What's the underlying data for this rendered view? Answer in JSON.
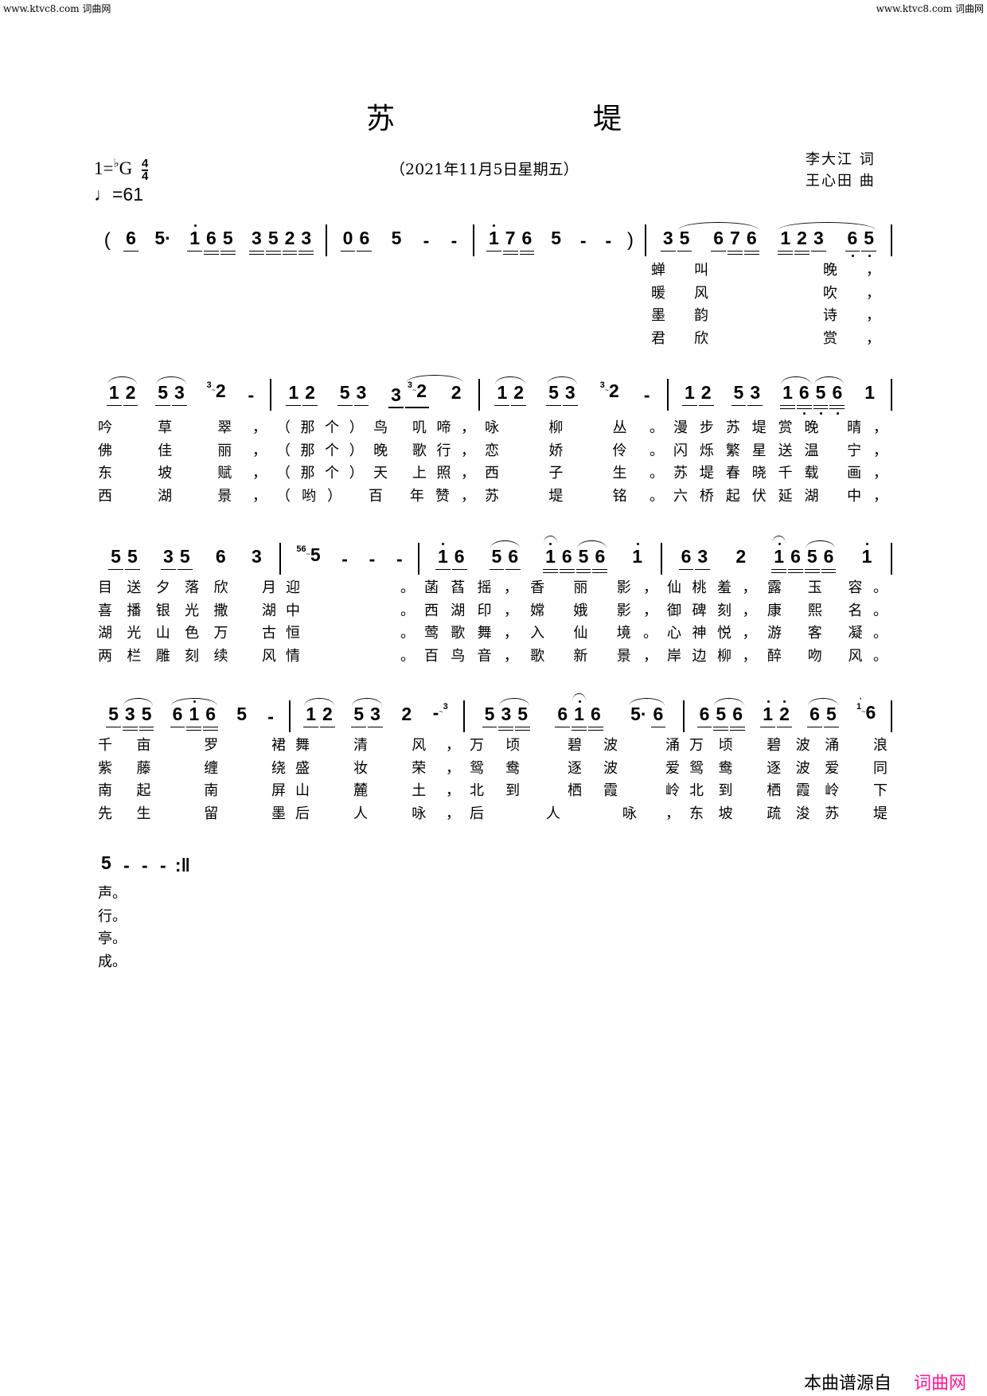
{
  "site": {
    "left": "www.ktvc8.com 词曲网",
    "right": "www.ktvc8.com 词曲网"
  },
  "title": [
    "苏",
    "堤"
  ],
  "key": {
    "prefix": "1=",
    "flat": "♭",
    "note": "G",
    "time_top": "4",
    "time_bottom": "4"
  },
  "tempo": {
    "symbol": "♩",
    "value": "=61"
  },
  "date": "（2021年11月5日星期五）",
  "lyricist": "李大江 词",
  "composer": "王心田 曲",
  "rows": [
    {
      "measures": [
        [
          "(",
          {
            "n": [
              "6"
            ],
            "u": [
              1
            ]
          },
          "5·",
          {
            "n": [
              "1'",
              "6",
              "5"
            ],
            "u": [
              1,
              2,
              2
            ]
          },
          {
            "n": [
              "3",
              "5",
              "2",
              "3"
            ],
            "u": [
              2,
              2,
              2,
              2
            ]
          }
        ],
        [
          {
            "n": [
              "0",
              "6"
            ],
            "u": [
              1,
              1
            ]
          },
          "5",
          "-",
          "-"
        ],
        [
          {
            "n": [
              "1'",
              "7",
              "6"
            ],
            "u": [
              1,
              2,
              2
            ]
          },
          "5",
          "-",
          "-",
          ")"
        ],
        [
          {
            "n": [
              "3",
              "5"
            ],
            "u": [
              1,
              1
            ],
            "s": [
              [
                1,
                1,
                "next"
              ]
            ]
          },
          {
            "n": [
              "6",
              "7",
              "6"
            ],
            "u": [
              1,
              2,
              2
            ],
            "s": [
              [
                -1,
                2
              ]
            ]
          },
          {
            "n": [
              "1",
              "2",
              "3"
            ],
            "u": [
              2,
              2,
              1
            ],
            "s": [
              [
                0,
                0,
                "next"
              ]
            ]
          },
          {
            "n": [
              "6,",
              "5,"
            ],
            "u": [
              1,
              1
            ],
            "s": [
              [
                -1,
                1
              ]
            ]
          }
        ]
      ],
      "verses": [
        [
          "",
          "",
          "",
          "蝉叫　　晚，　"
        ],
        [
          "",
          "",
          "",
          "暖风　　吹，　"
        ],
        [
          "",
          "",
          "",
          "墨韵　　诗，　"
        ],
        [
          "",
          "",
          "",
          "君欣　　赏，　"
        ]
      ]
    },
    {
      "measures": [
        [
          {
            "n": [
              "1",
              "2"
            ],
            "u": [
              1,
              1
            ],
            "s": [
              [
                0,
                1
              ]
            ]
          },
          {
            "n": [
              "5",
              "3"
            ],
            "u": [
              1,
              1
            ],
            "s": [
              [
                0,
                1
              ]
            ]
          },
          "3~2",
          "-"
        ],
        [
          {
            "n": [
              "1",
              "2"
            ],
            "u": [
              1,
              1
            ]
          },
          {
            "n": [
              "5",
              "3"
            ],
            "u": [
              1,
              1
            ]
          },
          {
            "n": [
              "3",
              "3~2"
            ],
            "u": [
              1,
              1
            ],
            "s": [
              [
                1,
                1,
                "next"
              ]
            ]
          },
          {
            "n": [
              "2"
            ],
            "u": [
              0
            ],
            "s": [
              [
                -1,
                0
              ]
            ]
          }
        ],
        [
          {
            "n": [
              "1",
              "2"
            ],
            "u": [
              1,
              1
            ],
            "s": [
              [
                0,
                1
              ]
            ]
          },
          {
            "n": [
              "5",
              "3"
            ],
            "u": [
              1,
              1
            ],
            "s": [
              [
                0,
                1
              ]
            ]
          },
          "3~2",
          "-"
        ],
        [
          {
            "n": [
              "1",
              "2"
            ],
            "u": [
              1,
              1
            ]
          },
          {
            "n": [
              "5",
              "3"
            ],
            "u": [
              1,
              1
            ]
          },
          {
            "n": [
              "1",
              "6,",
              "5,",
              "6,"
            ],
            "u": [
              2,
              2,
              2,
              2
            ],
            "s": [
              [
                0,
                1
              ],
              [
                2,
                3
              ]
            ]
          },
          "1"
        ]
      ],
      "verses": [
        [
          "吟 草 翠，",
          "（那个）鸟 叽啼，",
          "咏 柳 丛。",
          "漫步苏堤赏晚 晴，"
        ],
        [
          "佛 佳 丽，",
          "（那个）晚 歌行，",
          "恋 娇 伶。",
          "闪烁繁星送温 宁，"
        ],
        [
          "东 坡 赋，",
          "（那个）天 上照，",
          "西 子 生。",
          "苏堤春晓千载 画，"
        ],
        [
          "西 湖 景，",
          "（哟） 百 年赞，",
          "苏 堤 铭。",
          "六桥起伏延湖 中，"
        ]
      ]
    },
    {
      "measures": [
        [
          {
            "n": [
              "5",
              "5"
            ],
            "u": [
              1,
              1
            ]
          },
          {
            "n": [
              "3",
              "5"
            ],
            "u": [
              1,
              1
            ]
          },
          "6",
          "3"
        ],
        [
          "56~5",
          "-",
          "-",
          "-"
        ],
        [
          {
            "n": [
              "1'",
              "6"
            ],
            "u": [
              1,
              1
            ]
          },
          {
            "n": [
              "5",
              "6"
            ],
            "u": [
              1,
              1
            ],
            "s": [
              [
                0,
                1
              ]
            ]
          },
          {
            "n": [
              "1'",
              "6",
              "5",
              "6"
            ],
            "u": [
              2,
              2,
              2,
              2
            ],
            "s": [
              [
                0,
                0
              ],
              [
                2,
                3
              ]
            ]
          },
          "1'"
        ],
        [
          {
            "n": [
              "6",
              "3"
            ],
            "u": [
              1,
              1
            ]
          },
          "2",
          {
            "n": [
              "1'",
              "6",
              "5",
              "6"
            ],
            "u": [
              2,
              2,
              2,
              2
            ],
            "s": [
              [
                0,
                0
              ],
              [
                2,
                3
              ]
            ]
          },
          "1'"
        ]
      ],
      "verses": [
        [
          "目送夕落欣 月",
          "迎。",
          "菡萏摇，香 丽 影，",
          "仙桃羞，露 玉 容。"
        ],
        [
          "喜播银光撒 湖",
          "中。",
          "西湖印，嫦 娥 影，",
          "御碑刻，康 熙 名。"
        ],
        [
          "湖光山色万 古",
          "恒。",
          "莺歌舞，入 仙 境。",
          "心神悦，游 客 凝。"
        ],
        [
          "两栏雕刻续 风",
          "情。",
          "百鸟音，歌 新 景，",
          "岸边柳，醉 吻 风。"
        ]
      ]
    },
    {
      "measures": [
        [
          {
            "n": [
              "5",
              "3",
              "5"
            ],
            "u": [
              1,
              2,
              2
            ],
            "s": [
              [
                1,
                2
              ]
            ]
          },
          {
            "n": [
              "6",
              "1'",
              "6"
            ],
            "u": [
              1,
              2,
              2
            ],
            "s": [
              [
                0,
                2
              ]
            ]
          },
          "5",
          "-"
        ],
        [
          {
            "n": [
              "1",
              "2"
            ],
            "u": [
              1,
              1
            ],
            "s": [
              [
                0,
                1
              ]
            ]
          },
          {
            "n": [
              "5",
              "3"
            ],
            "u": [
              1,
              1
            ],
            "s": [
              [
                0,
                1
              ]
            ]
          },
          "2",
          "-~3"
        ],
        [
          {
            "n": [
              "5",
              "3",
              "5"
            ],
            "u": [
              1,
              2,
              2
            ],
            "s": [
              [
                1,
                2
              ]
            ]
          },
          {
            "n": [
              "6",
              "1'",
              "6"
            ],
            "u": [
              1,
              2,
              2
            ],
            "s": [
              [
                1,
                1
              ]
            ]
          },
          {
            "n": [
              "5·",
              "6"
            ],
            "u": [
              0,
              1
            ],
            "s": [
              [
                0,
                1
              ]
            ]
          }
        ],
        [
          {
            "n": [
              "6",
              "5",
              "6"
            ],
            "u": [
              1,
              2,
              2
            ],
            "s": [
              [
                1,
                2
              ]
            ]
          },
          {
            "n": [
              "1'",
              "2'"
            ],
            "u": [
              1,
              1
            ]
          },
          {
            "n": [
              "6",
              "5"
            ],
            "u": [
              1,
              1
            ],
            "s": [
              [
                0,
                1
              ]
            ]
          },
          "1'~6"
        ]
      ],
      "verses": [
        [
          "千亩 罗 裙",
          "舞 清 风，",
          "万顷 碧波 涌",
          "万顷 碧波涌 浪"
        ],
        [
          "紫藤 缠 绕",
          "盛 妆 荣，",
          "鸳鸯 逐波 爱",
          "鸳鸯 逐波爱 同"
        ],
        [
          "南起 南 屏",
          "山 麓 土，",
          "北到 栖霞 岭",
          "北到 栖霞岭 下"
        ],
        [
          "先生 留 墨",
          "后 人 咏，",
          "后 人 咏，",
          "东坡 疏浚苏 堤"
        ]
      ]
    },
    {
      "measures": [
        [
          "5",
          "-",
          "-",
          "-",
          ":‖"
        ]
      ],
      "verses": [
        [
          "声。"
        ],
        [
          "行。"
        ],
        [
          "亭。"
        ],
        [
          "成。"
        ]
      ]
    }
  ],
  "footer": {
    "source_label": "本曲谱源自",
    "brand": "词曲网",
    "brand_color": "#ff1493"
  }
}
